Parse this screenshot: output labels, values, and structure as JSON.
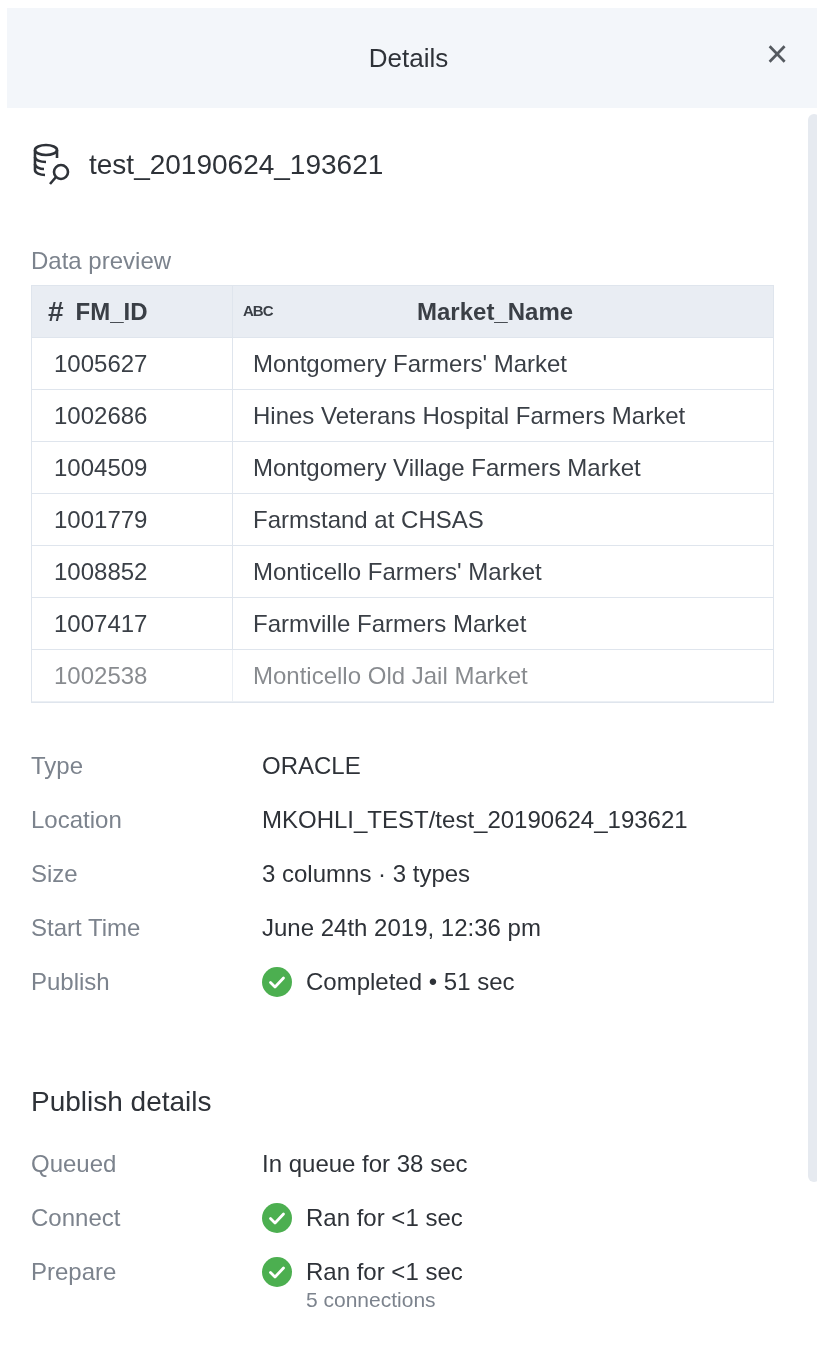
{
  "header": {
    "title": "Details",
    "close": "×"
  },
  "dataset": {
    "name": "test_20190624_193621"
  },
  "preview": {
    "label": "Data preview",
    "columns": [
      {
        "kind": "number",
        "type_icon": "#",
        "name": "FM_ID"
      },
      {
        "kind": "text",
        "type_icon": "ABC",
        "name": "Market_Name"
      }
    ],
    "rows": [
      {
        "faded": false,
        "cells": [
          "1005627",
          "Montgomery Farmers' Market"
        ]
      },
      {
        "faded": false,
        "cells": [
          "1002686",
          "Hines Veterans Hospital Farmers Market"
        ]
      },
      {
        "faded": false,
        "cells": [
          "1004509",
          "Montgomery Village Farmers Market"
        ]
      },
      {
        "faded": false,
        "cells": [
          "1001779",
          "Farmstand at CHSAS"
        ]
      },
      {
        "faded": false,
        "cells": [
          "1008852",
          "Monticello Farmers' Market"
        ]
      },
      {
        "faded": false,
        "cells": [
          "1007417",
          "Farmville Farmers Market"
        ]
      },
      {
        "faded": true,
        "cells": [
          "1002538",
          "Monticello Old Jail Market"
        ]
      }
    ]
  },
  "properties": [
    {
      "label": "Type",
      "value": "ORACLE",
      "completed": false
    },
    {
      "label": "Location",
      "value": "MKOHLI_TEST/test_20190624_193621",
      "completed": false
    },
    {
      "label": "Size",
      "value": "3 columns · 3 types",
      "completed": false
    },
    {
      "label": "Start Time",
      "value": "June 24th 2019, 12:36 pm",
      "completed": false
    },
    {
      "label": "Publish",
      "value": "Completed • 51 sec",
      "completed": true
    }
  ],
  "publish_details": {
    "title": "Publish details",
    "steps": [
      {
        "label": "Queued",
        "value": "In queue for 38 sec",
        "completed": false
      },
      {
        "label": "Connect",
        "value": "Ran for <1 sec",
        "completed": true
      },
      {
        "label": "Prepare",
        "value": "Ran for <1 sec",
        "completed": true,
        "note": "5 connections"
      }
    ]
  }
}
